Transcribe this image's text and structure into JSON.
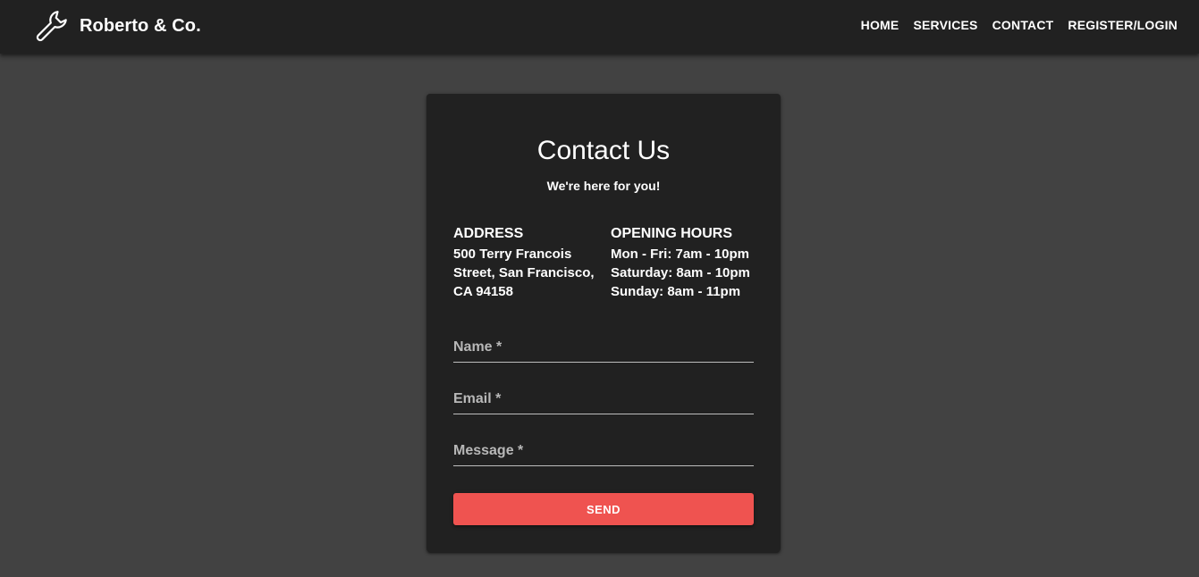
{
  "brand": {
    "name": "Roberto & Co.",
    "icon": "wrench-icon"
  },
  "nav": {
    "items": [
      {
        "label": "HOME"
      },
      {
        "label": "SERVICES"
      },
      {
        "label": "CONTACT"
      },
      {
        "label": "REGISTER/LOGIN"
      }
    ]
  },
  "contact": {
    "title": "Contact Us",
    "subtitle": "We're here for you!",
    "address": {
      "heading": "ADDRESS",
      "lines": [
        "500 Terry Francois",
        "Street, San Francisco,",
        "CA 94158"
      ]
    },
    "hours": {
      "heading": "OPENING HOURS",
      "lines": [
        "Mon - Fri: 7am - 10pm",
        "Saturday: 8am - 10pm",
        "Sunday: 8am - 11pm"
      ]
    },
    "form": {
      "name_label": "Name *",
      "email_label": "Email *",
      "message_label": "Message *",
      "send_label": "SEND"
    }
  },
  "colors": {
    "page_background": "#424242",
    "appbar_background": "#212121",
    "card_background": "#212121",
    "accent": "#ef5350",
    "text": "#ffffff",
    "field_label": "#b8b8b8"
  }
}
